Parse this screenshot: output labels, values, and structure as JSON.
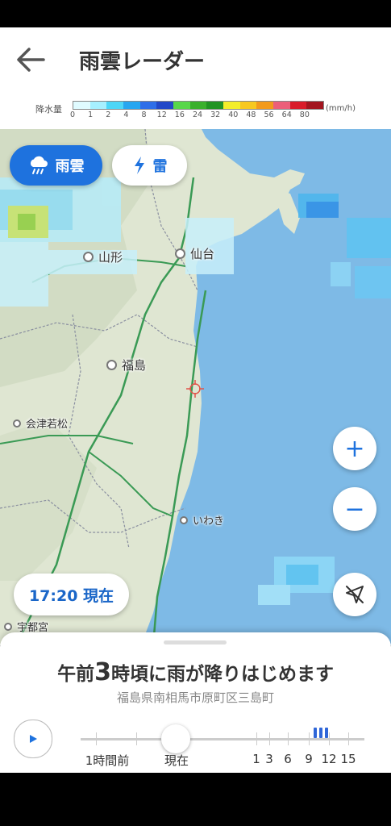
{
  "header": {
    "title": "雨雲レーダー"
  },
  "legend": {
    "label": "降水量",
    "unit": "(mm/h)",
    "ticks": [
      "0",
      "1",
      "2",
      "4",
      "8",
      "12",
      "16",
      "24",
      "32",
      "40",
      "48",
      "56",
      "64",
      "80"
    ],
    "colors": [
      "#e0fbff",
      "#a6f0ff",
      "#4dd6f7",
      "#27a6f0",
      "#2e6ee8",
      "#2248c8",
      "#58d74a",
      "#3ab02c",
      "#219423",
      "#f4ee2b",
      "#f7c81f",
      "#f29a1c",
      "#ec5f7a",
      "#d91c2a",
      "#a3151f"
    ]
  },
  "layers": {
    "rain": "雨雲",
    "thunder": "雷"
  },
  "map": {
    "cities": {
      "sendai": "仙台",
      "yamagata": "山形",
      "fukushima": "福島",
      "aizuwakamatsu": "会津若松",
      "iwaki": "いわき",
      "utsunomiya": "宇都宮"
    }
  },
  "controls": {
    "zoom_in": "+",
    "zoom_out": "−"
  },
  "current_time": "17:20 現在",
  "forecast": {
    "prefix": "午前",
    "hour": "3",
    "suffix": "時頃に雨が降りはじめます",
    "address": "福島県南相馬市原町区三島町"
  },
  "timeline": {
    "labels": [
      "1時間前",
      "現在",
      "1",
      "3",
      "6",
      "9",
      "12",
      "15"
    ]
  },
  "colors": {
    "accent": "#1e72de",
    "sea": "#7ebae6",
    "land": "#dfe6d2",
    "rain_band": "#2f66d8"
  }
}
